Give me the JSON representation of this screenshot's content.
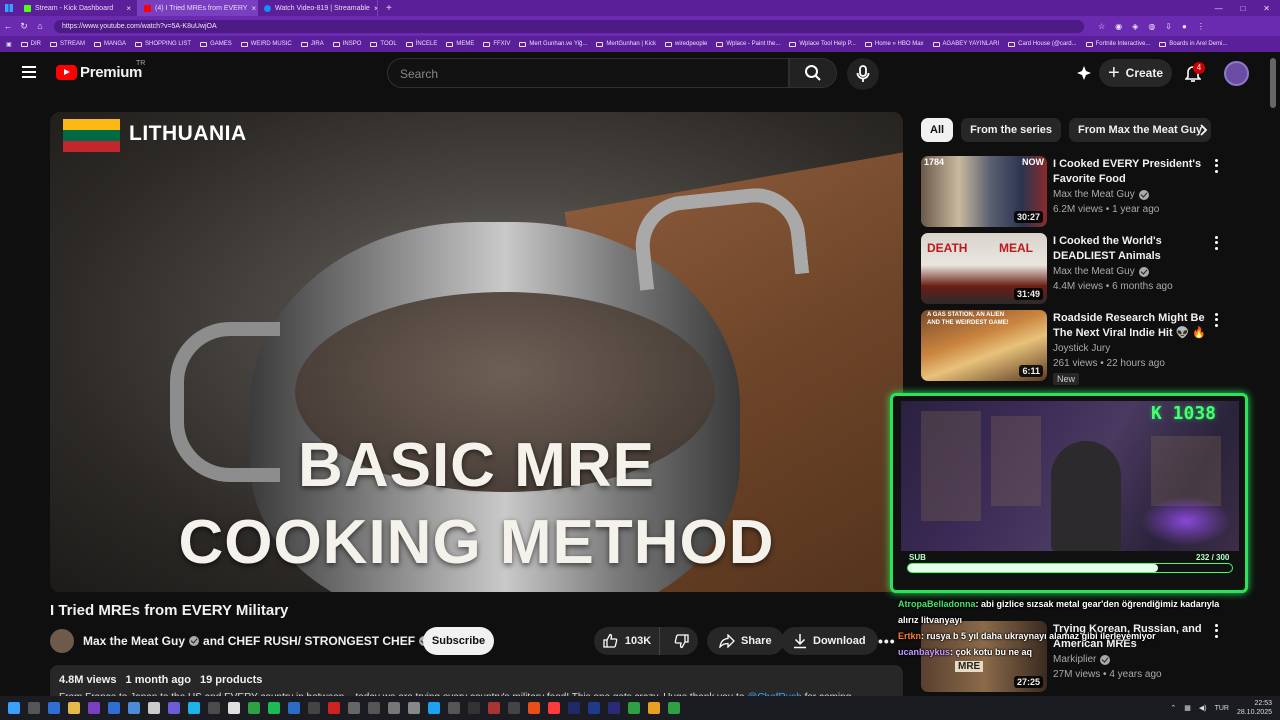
{
  "browser": {
    "tabs": [
      {
        "label": "Stream - Kick Dashboard",
        "color": "#53fc18"
      },
      {
        "label": "(4) I Tried MREs from EVERY",
        "color": "#ff0000"
      },
      {
        "label": "Watch Video-819 | Streamable",
        "color": "#0f90fa"
      }
    ],
    "url": "https://www.youtube.com/watch?v=5A-K8uUwjOA",
    "bookmarks": [
      "DIR",
      "STREAM",
      "MANGA",
      "SHOPPING LIST",
      "GAMES",
      "WEIRD MUSIC",
      "JIRA",
      "INSPO",
      "TOOL",
      "İNCELE",
      "MEME",
      "FFXIV",
      "Mert Gunhan.ve Yiğ...",
      "MertGunhan | Kick",
      "wiredpeople",
      "Wplace - Paint the...",
      "Wplace Tool Help P...",
      "Home » HBO Max",
      "AGABEY YAYINLARI",
      "Card House (@card...",
      "Fortnite Interactive...",
      "Boards in Arel Demi..."
    ]
  },
  "header": {
    "logo_text": "Premium",
    "logo_sup": "TR",
    "search_placeholder": "Search",
    "create_label": "Create",
    "notif_count": "4"
  },
  "video": {
    "country": "LITHUANIA",
    "overlay_line1": "BASIC MRE",
    "overlay_line2": "COOKING METHOD",
    "title": "I Tried MREs from EVERY Military",
    "channel": "Max the Meat Guy",
    "and_text": "and CHEF RUSH/ STRONGEST CHEF",
    "subscribe_label": "Subscribe",
    "likes": "103K",
    "share_label": "Share",
    "download_label": "Download",
    "views": "4.8M views",
    "age": "1 month ago",
    "products": "19 products",
    "desc_text": "From France to Japan to the US and EVERY country in between... today we are trying every country's military food! This one gets crazy. Huge thank you to",
    "desc_link": "@ChefRush",
    "desc_end": "for coming"
  },
  "chips": [
    "All",
    "From the series",
    "From Max the Meat Guy"
  ],
  "recommended": [
    {
      "title": "I Cooked EVERY President's Favorite Food",
      "channel": "Max the Meat Guy",
      "views": "6.2M views",
      "age": "1 year ago",
      "duration": "30:27",
      "thumb_label": "1784",
      "thumb_label2": "NOW"
    },
    {
      "title": "I Cooked the World's DEADLIEST Animals",
      "channel": "Max the Meat Guy",
      "views": "4.4M views",
      "age": "6 months ago",
      "duration": "31:49",
      "thumb_label": "DEATH",
      "thumb_label2": "MEAL"
    },
    {
      "title": "Roadside Research Might Be The Next Viral Indie Hit 👽 🔥",
      "channel": "Joystick Jury",
      "views": "261 views",
      "age": "22 hours ago",
      "duration": "6:11",
      "badge": "New",
      "thumb_label": "A GAS STATION, AN ALIEN",
      "thumb_label2": "AND THE WEIRDEST GAME!"
    },
    {
      "title": "Trying Korean, Russian, and American MREs",
      "channel": "Markiplier",
      "views": "27M views",
      "age": "4 years ago",
      "duration": "27:25",
      "thumb_label": "MRE"
    }
  ],
  "stream": {
    "k_count": "K 1038",
    "sub_label": "SUB",
    "sub_count": "232 / 300",
    "sub_progress": 0.773,
    "chat": [
      {
        "user": "AtropaBelladonna",
        "sep": ": ",
        "msg": "abi gizlice sızsak metal gear'den öğrendiğimiz kadarıyla"
      },
      {
        "user": "",
        "sep": "",
        "msg": "alırız litvanyayı"
      },
      {
        "user": "Ertkn",
        "sep": ": ",
        "msg": "rusya b 5 yıl daha ukraynayı alamaz gibi ilerleyemiyor"
      },
      {
        "user": "ucanbaykus",
        "sep": ": ",
        "msg": "çok kotu bu ne aq"
      }
    ]
  },
  "taskbar": {
    "lang": "TUR",
    "time": "22:53",
    "date": "28.10.2025"
  }
}
